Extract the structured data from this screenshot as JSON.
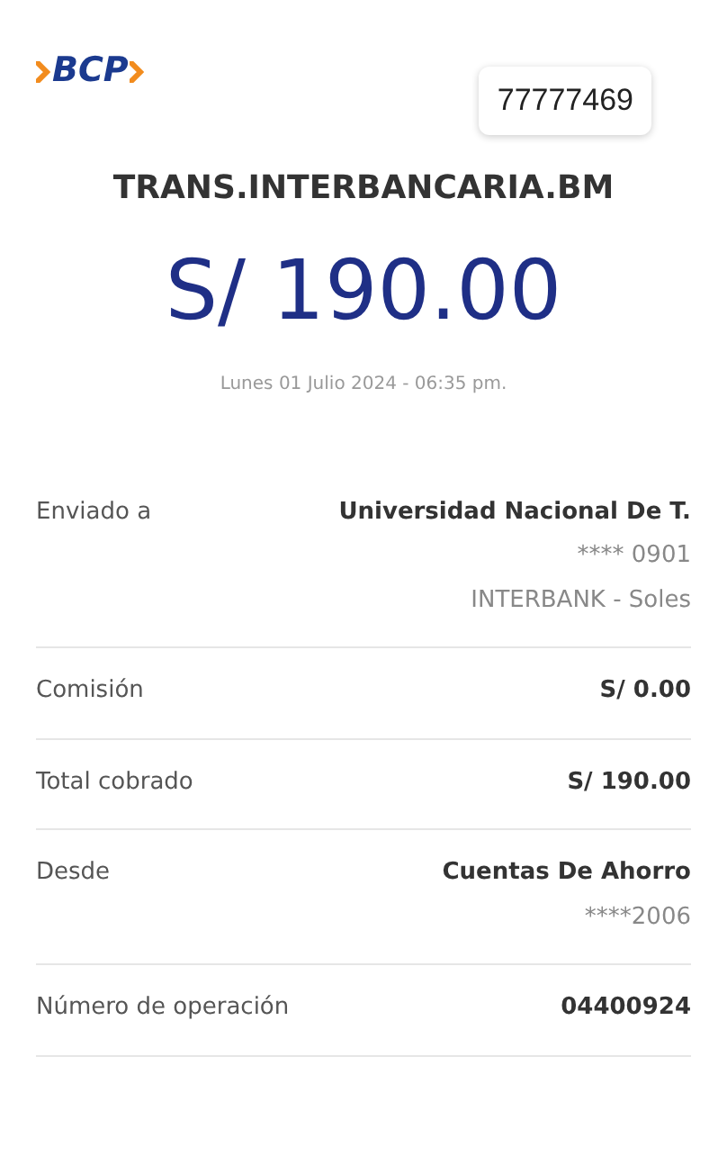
{
  "logo": {
    "text": "BCP"
  },
  "badge": "77777469",
  "title": "TRANS.INTERBANCARIA.BM",
  "amount": "S/ 190.00",
  "date": "Lunes 01 Julio 2024 - 06:35 pm.",
  "details": [
    {
      "label": "Enviado a",
      "value": "Universidad Nacional De T.",
      "extra": [
        "**** 0901",
        "INTERBANK - Soles"
      ]
    },
    {
      "label": "Comisión",
      "value": "S/ 0.00"
    },
    {
      "label": "Total cobrado",
      "value": "S/ 190.00"
    },
    {
      "label": "Desde",
      "value": "Cuentas De Ahorro",
      "extra": [
        "****2006"
      ]
    },
    {
      "label": "Número de operación",
      "value": "04400924"
    }
  ]
}
